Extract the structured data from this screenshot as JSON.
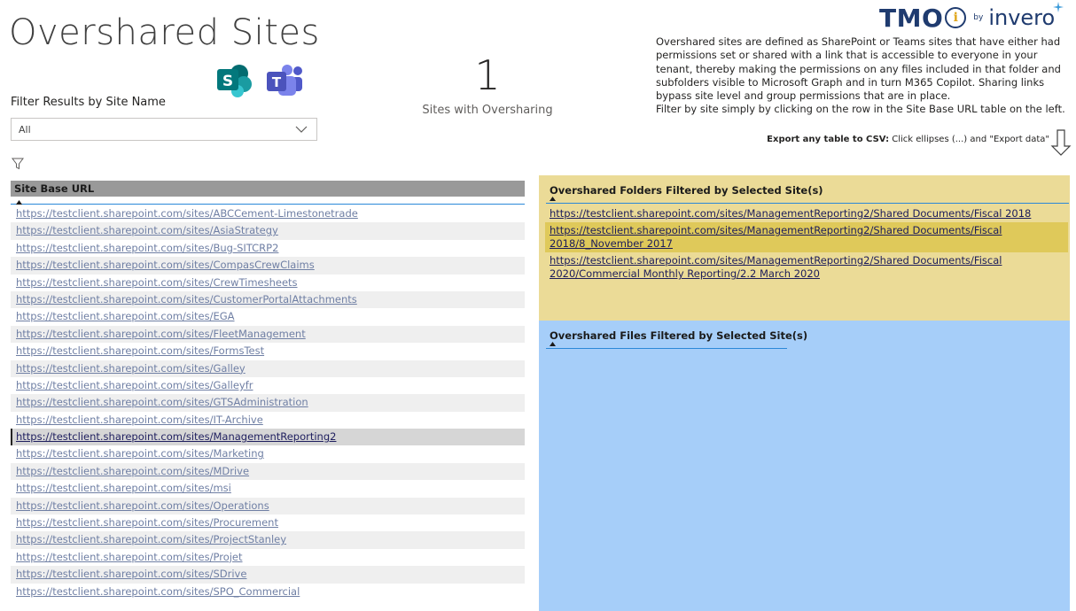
{
  "page": {
    "title": "Overshared Sites"
  },
  "filter": {
    "label": "Filter Results by Site Name",
    "selected": "All"
  },
  "kpi": {
    "value": "1",
    "label": "Sites with Oversharing"
  },
  "brand": {
    "name": "TMO",
    "by": "by",
    "partner": "invero"
  },
  "description": {
    "text": "Overshared sites are defined as SharePoint or Teams sites that have either had permissions set or shared with a link that is accessible to everyone in your tenant, thereby making the permissions on any files included in that folder and subfolders visible to Microsoft Graph and in turn M365 Copilot.  Sharing links bypass site level and group permissions that are in place.",
    "filter_hint": "Filter by site simply by clicking on the row in the Site Base URL table on the left."
  },
  "export": {
    "bold": "Export any table to CSV:",
    "rest": " Click ellipses (...) and \"Export data\""
  },
  "site_table": {
    "header": "Site Base URL",
    "rows": [
      "https://testclient.sharepoint.com/sites/ABCCement-Limestonetrade",
      "https://testclient.sharepoint.com/sites/AsiaStrategy",
      "https://testclient.sharepoint.com/sites/Bug-SITCRP2",
      "https://testclient.sharepoint.com/sites/CompasCrewClaims",
      "https://testclient.sharepoint.com/sites/CrewTimesheets",
      "https://testclient.sharepoint.com/sites/CustomerPortalAttachments",
      "https://testclient.sharepoint.com/sites/EGA",
      "https://testclient.sharepoint.com/sites/FleetManagement",
      "https://testclient.sharepoint.com/sites/FormsTest",
      "https://testclient.sharepoint.com/sites/Galley",
      "https://testclient.sharepoint.com/sites/Galleyfr",
      "https://testclient.sharepoint.com/sites/GTSAdministration",
      "https://testclient.sharepoint.com/sites/IT-Archive",
      "https://testclient.sharepoint.com/sites/ManagementReporting2",
      "https://testclient.sharepoint.com/sites/Marketing",
      "https://testclient.sharepoint.com/sites/MDrive",
      "https://testclient.sharepoint.com/sites/msi",
      "https://testclient.sharepoint.com/sites/Operations",
      "https://testclient.sharepoint.com/sites/Procurement",
      "https://testclient.sharepoint.com/sites/ProjectStanley",
      "https://testclient.sharepoint.com/sites/Projet",
      "https://testclient.sharepoint.com/sites/SDrive",
      "https://testclient.sharepoint.com/sites/SPO_Commercial"
    ]
  },
  "folders_table": {
    "header": "Overshared Folders Filtered by Selected Site(s)",
    "rows": [
      "https://testclient.sharepoint.com/sites/ManagementReporting2/Shared Documents/Fiscal 2018",
      "https://testclient.sharepoint.com/sites/ManagementReporting2/Shared Documents/Fiscal 2018/8_November 2017",
      "https://testclient.sharepoint.com/sites/ManagementReporting2/Shared Documents/Fiscal 2020/Commercial Monthly Reporting/2.2 March 2020"
    ]
  },
  "files_table": {
    "header": "Overshared Files Filtered by Selected Site(s)"
  },
  "colors": {
    "folders_panel": "#ebdb97",
    "files_panel": "#a6cef9",
    "header_gray": "#999999",
    "brand_navy": "#1f3b6f",
    "accent_blue": "#2b88d8"
  }
}
